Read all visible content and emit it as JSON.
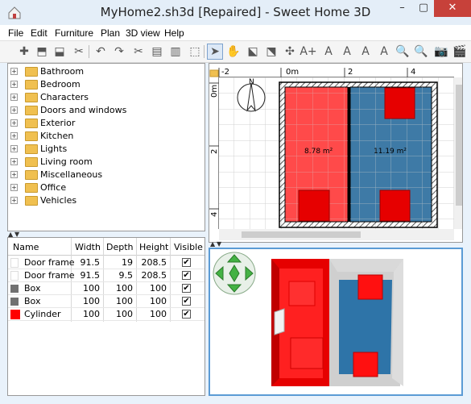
{
  "window": {
    "title": "MyHome2.sh3d [Repaired] - Sweet Home 3D",
    "min_label": "–",
    "max_label": "▢",
    "close_label": "✕"
  },
  "menu": [
    "File",
    "Edit",
    "Furniture",
    "Plan",
    "3D view",
    "Help"
  ],
  "catalog": {
    "categories": [
      "Bathroom",
      "Bedroom",
      "Characters",
      "Doors and windows",
      "Exterior",
      "Kitchen",
      "Lights",
      "Living room",
      "Miscellaneous",
      "Office",
      "Vehicles"
    ]
  },
  "furniture": {
    "columns": [
      "Name",
      "Width",
      "Depth",
      "Height",
      "Visible"
    ],
    "rows": [
      {
        "name": "Door frame",
        "width": "91.5",
        "depth": "19",
        "height": "208.5",
        "visible": "✔",
        "icon_color": "#ffffff"
      },
      {
        "name": "Door frame",
        "width": "91.5",
        "depth": "9.5",
        "height": "208.5",
        "visible": "✔",
        "icon_color": "#ffffff"
      },
      {
        "name": "Box",
        "width": "100",
        "depth": "100",
        "height": "100",
        "visible": "✔",
        "icon_color": "#707070"
      },
      {
        "name": "Box",
        "width": "100",
        "depth": "100",
        "height": "100",
        "visible": "✔",
        "icon_color": "#707070"
      },
      {
        "name": "Cylinder",
        "width": "100",
        "depth": "100",
        "height": "100",
        "visible": "✔",
        "icon_color": "#ff0000"
      }
    ]
  },
  "plan": {
    "ruler_top": [
      "-2",
      "0m",
      "2",
      "4"
    ],
    "ruler_left": [
      "0m",
      "2",
      "4"
    ],
    "rooms": [
      {
        "area": "8.78 m²",
        "color": "#ff4a4a"
      },
      {
        "area": "11.19 m²",
        "color": "#3e7aa6"
      }
    ]
  },
  "toolbar_glyphs": [
    "✚",
    "⬒",
    "⬓",
    "✂",
    "↶",
    "↷",
    "✂",
    "▤",
    "▥",
    "⬚",
    "➤",
    "✋",
    "⬕",
    "⬔",
    "✣",
    "A+",
    "A",
    "A",
    "A",
    "A",
    "🔍",
    "🔍",
    "📷",
    "🎬"
  ]
}
